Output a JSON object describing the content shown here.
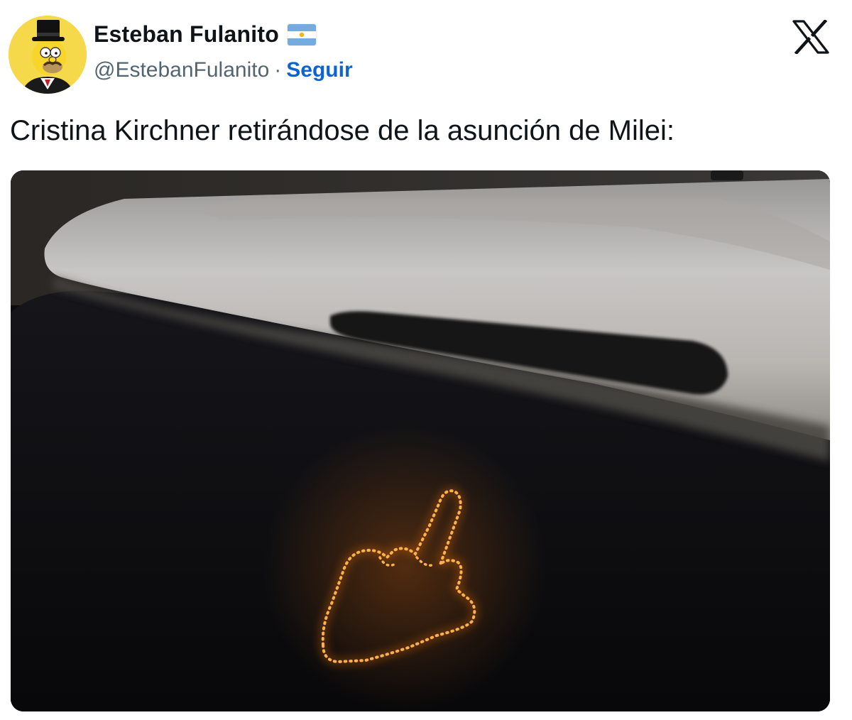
{
  "tweet": {
    "author": {
      "display_name": "Esteban Fulanito",
      "flag_icon": "argentina-flag-icon",
      "handle": "@EstebanFulanito",
      "separator": "·",
      "follow_label": "Seguir"
    },
    "text": "Cristina Kirchner retirándose de la asunción de Milei:",
    "platform_icon": "x-logo-icon"
  },
  "colors": {
    "follow_link": "#0d64cf",
    "name_text": "#0f1419",
    "handle_text": "#536471",
    "led_orange": "#ff8a1c"
  }
}
